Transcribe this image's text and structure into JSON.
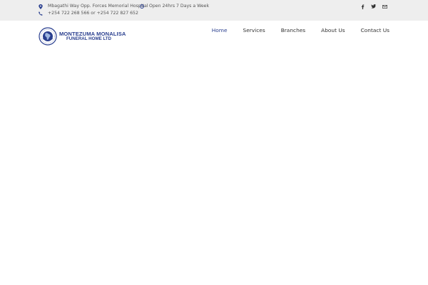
{
  "topbar": {
    "address": "Mbagathi Way Opp. Forces Memorial Hospital",
    "hours": "Open 24hrs 7 Days a Week",
    "phone": "+254 722 268 566 or +254 722 827 652",
    "icons": {
      "address": "map-marker-icon",
      "hours": "clock-icon",
      "phone": "phone-icon"
    },
    "social": [
      "facebook-icon",
      "twitter-icon",
      "envelope-icon"
    ]
  },
  "logo": {
    "line1": "MONTEZUMA MONALISA",
    "line2": "FUNERAL HOME LTD",
    "color": "#2a3f8f"
  },
  "nav": {
    "items": [
      {
        "label": "Home"
      },
      {
        "label": "Services"
      },
      {
        "label": "Branches"
      },
      {
        "label": "About Us"
      },
      {
        "label": "Contact Us"
      }
    ]
  }
}
